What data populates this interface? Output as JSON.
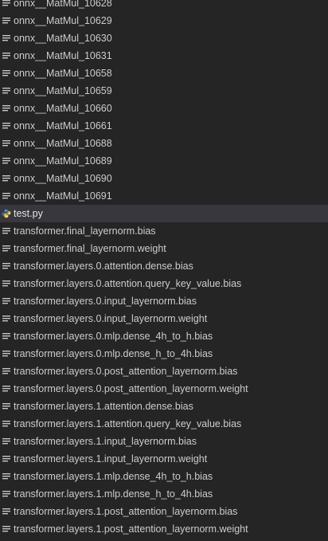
{
  "explorer": {
    "selected_index": 12,
    "colors": {
      "background": "#252526",
      "selected_row": "#37373d",
      "text": "#cccccc",
      "generic_icon": "#c5c5c5",
      "python_blue": "#3a75b0",
      "python_yellow": "#f4d03f"
    },
    "files": [
      {
        "name": "onnx__MatMul_10628",
        "icon": "generic-file-icon"
      },
      {
        "name": "onnx__MatMul_10629",
        "icon": "generic-file-icon"
      },
      {
        "name": "onnx__MatMul_10630",
        "icon": "generic-file-icon"
      },
      {
        "name": "onnx__MatMul_10631",
        "icon": "generic-file-icon"
      },
      {
        "name": "onnx__MatMul_10658",
        "icon": "generic-file-icon"
      },
      {
        "name": "onnx__MatMul_10659",
        "icon": "generic-file-icon"
      },
      {
        "name": "onnx__MatMul_10660",
        "icon": "generic-file-icon"
      },
      {
        "name": "onnx__MatMul_10661",
        "icon": "generic-file-icon"
      },
      {
        "name": "onnx__MatMul_10688",
        "icon": "generic-file-icon"
      },
      {
        "name": "onnx__MatMul_10689",
        "icon": "generic-file-icon"
      },
      {
        "name": "onnx__MatMul_10690",
        "icon": "generic-file-icon"
      },
      {
        "name": "onnx__MatMul_10691",
        "icon": "generic-file-icon"
      },
      {
        "name": "test.py",
        "icon": "python-file-icon"
      },
      {
        "name": "transformer.final_layernorm.bias",
        "icon": "generic-file-icon"
      },
      {
        "name": "transformer.final_layernorm.weight",
        "icon": "generic-file-icon"
      },
      {
        "name": "transformer.layers.0.attention.dense.bias",
        "icon": "generic-file-icon"
      },
      {
        "name": "transformer.layers.0.attention.query_key_value.bias",
        "icon": "generic-file-icon"
      },
      {
        "name": "transformer.layers.0.input_layernorm.bias",
        "icon": "generic-file-icon"
      },
      {
        "name": "transformer.layers.0.input_layernorm.weight",
        "icon": "generic-file-icon"
      },
      {
        "name": "transformer.layers.0.mlp.dense_4h_to_h.bias",
        "icon": "generic-file-icon"
      },
      {
        "name": "transformer.layers.0.mlp.dense_h_to_4h.bias",
        "icon": "generic-file-icon"
      },
      {
        "name": "transformer.layers.0.post_attention_layernorm.bias",
        "icon": "generic-file-icon"
      },
      {
        "name": "transformer.layers.0.post_attention_layernorm.weight",
        "icon": "generic-file-icon"
      },
      {
        "name": "transformer.layers.1.attention.dense.bias",
        "icon": "generic-file-icon"
      },
      {
        "name": "transformer.layers.1.attention.query_key_value.bias",
        "icon": "generic-file-icon"
      },
      {
        "name": "transformer.layers.1.input_layernorm.bias",
        "icon": "generic-file-icon"
      },
      {
        "name": "transformer.layers.1.input_layernorm.weight",
        "icon": "generic-file-icon"
      },
      {
        "name": "transformer.layers.1.mlp.dense_4h_to_h.bias",
        "icon": "generic-file-icon"
      },
      {
        "name": "transformer.layers.1.mlp.dense_h_to_4h.bias",
        "icon": "generic-file-icon"
      },
      {
        "name": "transformer.layers.1.post_attention_layernorm.bias",
        "icon": "generic-file-icon"
      },
      {
        "name": "transformer.layers.1.post_attention_layernorm.weight",
        "icon": "generic-file-icon"
      }
    ]
  }
}
